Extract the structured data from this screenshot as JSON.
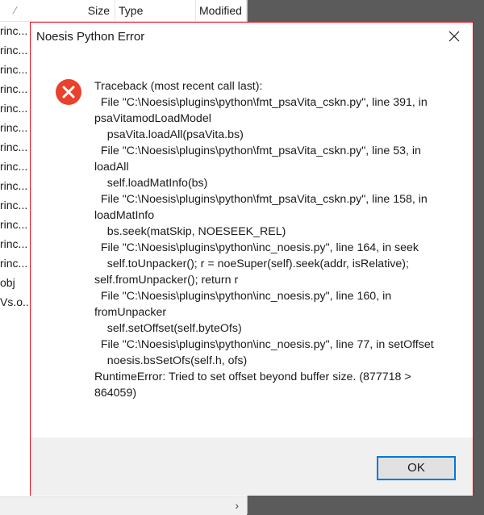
{
  "explorer": {
    "columns": {
      "size": "Size",
      "type": "Type",
      "modified": "Modified"
    },
    "rows": [
      "rinc...",
      "rinc...",
      "rinc...",
      "rinc...",
      "rinc...",
      "rinc...",
      "rinc...",
      "rinc...",
      "rinc...",
      "rinc...",
      "rinc...",
      "rinc...",
      "rinc...",
      "obj",
      "Vs.o..."
    ]
  },
  "dialog": {
    "title": "Noesis Python Error",
    "icon": "error-icon",
    "message": "Traceback (most recent call last):\n  File \"C:\\Noesis\\plugins\\python\\fmt_psaVita_cskn.py\", line 391, in psaVitamodLoadModel\n    psaVita.loadAll(psaVita.bs)\n  File \"C:\\Noesis\\plugins\\python\\fmt_psaVita_cskn.py\", line 53, in loadAll\n    self.loadMatInfo(bs)\n  File \"C:\\Noesis\\plugins\\python\\fmt_psaVita_cskn.py\", line 158, in loadMatInfo\n    bs.seek(matSkip, NOESEEK_REL)\n  File \"C:\\Noesis\\plugins\\python\\inc_noesis.py\", line 164, in seek\n    self.toUnpacker(); r = noeSuper(self).seek(addr, isRelative); self.fromUnpacker(); return r\n  File \"C:\\Noesis\\plugins\\python\\inc_noesis.py\", line 160, in fromUnpacker\n    self.setOffset(self.byteOfs)\n  File \"C:\\Noesis\\plugins\\python\\inc_noesis.py\", line 77, in setOffset\n    noesis.bsSetOfs(self.h, ofs)\nRuntimeError: Tried to set offset beyond buffer size. (877718 > 864059)",
    "ok_label": "OK",
    "accent_color": "#e81123",
    "focus_color": "#0078d7"
  }
}
